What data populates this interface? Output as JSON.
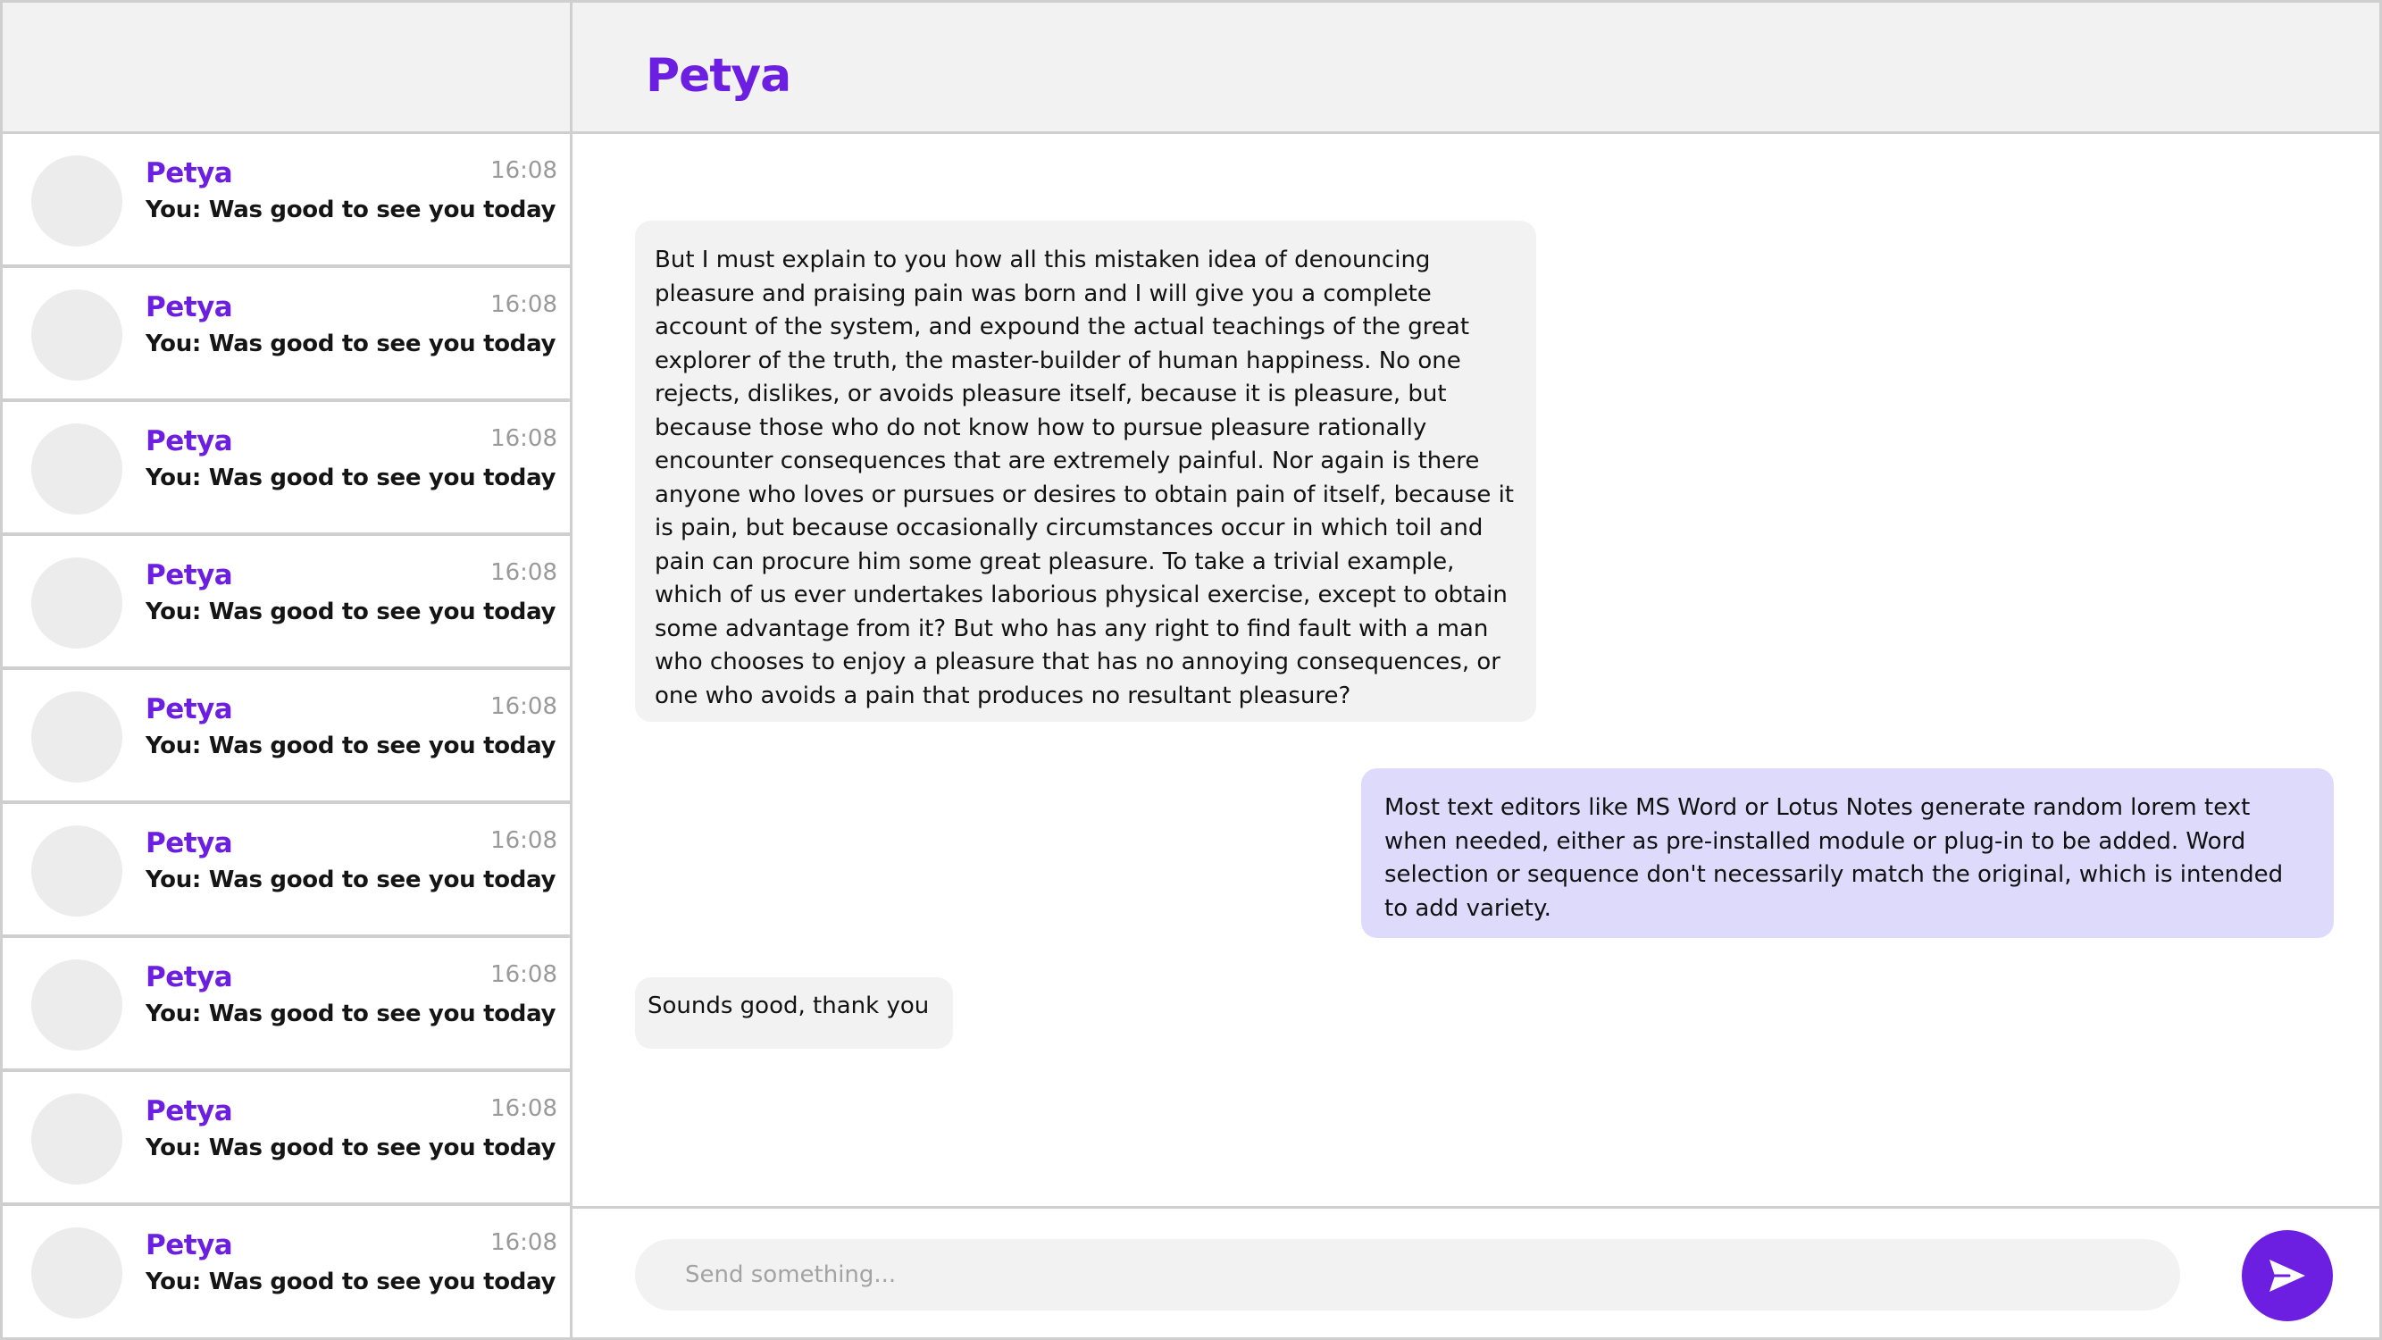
{
  "colors": {
    "accent": "#6c1fe0",
    "incoming_bubble": "#f2f2f2",
    "outgoing_bubble": "#dedafc",
    "header_bg": "#f2f2f2"
  },
  "chat": {
    "title": "Petya"
  },
  "conversations": [
    {
      "name": "Petya",
      "time": "16:08",
      "preview": "You: Was good to see you today"
    },
    {
      "name": "Petya",
      "time": "16:08",
      "preview": "You: Was good to see you today"
    },
    {
      "name": "Petya",
      "time": "16:08",
      "preview": "You: Was good to see you today"
    },
    {
      "name": "Petya",
      "time": "16:08",
      "preview": "You: Was good to see you today"
    },
    {
      "name": "Petya",
      "time": "16:08",
      "preview": "You: Was good to see you today"
    },
    {
      "name": "Petya",
      "time": "16:08",
      "preview": "You: Was good to see you today"
    },
    {
      "name": "Petya",
      "time": "16:08",
      "preview": "You: Was good to see you today"
    },
    {
      "name": "Petya",
      "time": "16:08",
      "preview": "You: Was good to see you today"
    },
    {
      "name": "Petya",
      "time": "16:08",
      "preview": "You: Was good to see you today"
    }
  ],
  "messages": [
    {
      "direction": "incoming",
      "text": "But I must explain to you how all this mistaken idea of denouncing pleasure and praising pain was born and I will give you a complete account of the system, and expound the actual teachings of the great explorer of the truth, the master-builder of human happiness. No one rejects, dislikes, or avoids pleasure itself, because it is pleasure, but because those who do not know how to pursue pleasure rationally encounter consequences that are extremely painful. Nor again is there anyone who loves or pursues or desires to obtain pain of itself, because it is pain, but because occasionally circumstances occur in which toil and pain can procure him some great pleasure. To take a trivial example, which of us ever undertakes laborious physical exercise, except to obtain some advantage from it? But who has any right to find fault with a man who chooses to enjoy a pleasure that has no annoying consequences, or one who avoids a pain that produces no resultant pleasure?"
    },
    {
      "direction": "outgoing",
      "text": "Most text editors like MS Word or Lotus Notes generate random lorem text when needed, either as pre-installed module or plug-in to be added. Word selection or sequence don't necessarily match the original, which is intended to add variety."
    },
    {
      "direction": "incoming",
      "text": "Sounds good, thank you"
    }
  ],
  "composer": {
    "placeholder": "Send something...",
    "send_icon": "send-icon"
  }
}
